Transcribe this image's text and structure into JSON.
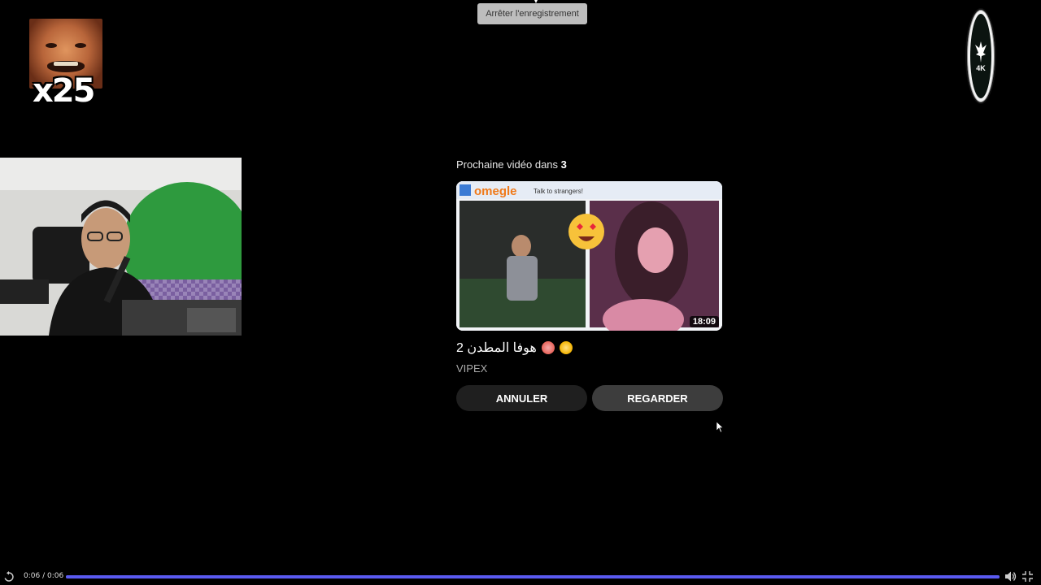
{
  "recording": {
    "stop_label": "Arrêter l'enregistrement"
  },
  "overlay": {
    "multiplier": "x25",
    "logo_text": "4K"
  },
  "next_video": {
    "countdown_prefix": "Prochaine vidéo dans",
    "countdown_value": "3",
    "thumbnail_header": "omegle",
    "thumbnail_tagline": "Talk to strangers!",
    "duration": "18:09",
    "title": "هوفا المطدن 2",
    "channel": "VIPEX",
    "cancel_label": "ANNULER",
    "watch_label": "REGARDER"
  },
  "player": {
    "time": "0:06 / 0:06",
    "progress": 1.0,
    "progress_color": "#5a5af0"
  }
}
